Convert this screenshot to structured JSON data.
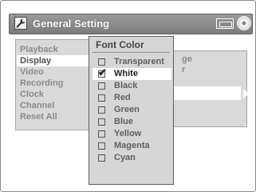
{
  "header": {
    "title": "General Setting",
    "icons": [
      "wrench-icon",
      "screen-icon",
      "disc-icon"
    ]
  },
  "menu": {
    "items": [
      {
        "label": "Playback",
        "selected": false
      },
      {
        "label": "Display",
        "selected": true
      },
      {
        "label": "Video",
        "selected": false
      },
      {
        "label": "Recording",
        "selected": false
      },
      {
        "label": "Clock",
        "selected": false
      },
      {
        "label": "Channel",
        "selected": false
      },
      {
        "label": "Reset All",
        "selected": false
      }
    ]
  },
  "submenu": {
    "partial_items": [
      "ge",
      "r"
    ]
  },
  "popup": {
    "title": "Font Color",
    "options": [
      {
        "label": "Transparent",
        "checked": false
      },
      {
        "label": "White",
        "checked": true
      },
      {
        "label": "Black",
        "checked": false
      },
      {
        "label": "Red",
        "checked": false
      },
      {
        "label": "Green",
        "checked": false
      },
      {
        "label": "Blue",
        "checked": false
      },
      {
        "label": "Yellow",
        "checked": false
      },
      {
        "label": "Magenta",
        "checked": false
      },
      {
        "label": "Cyan",
        "checked": false
      }
    ],
    "check_glyph": "✔"
  },
  "colors": {
    "header": "#8a8a8a",
    "panel": "#d9d9d9",
    "highlight": "#ffffff",
    "text_dim": "#8a8a8a"
  }
}
